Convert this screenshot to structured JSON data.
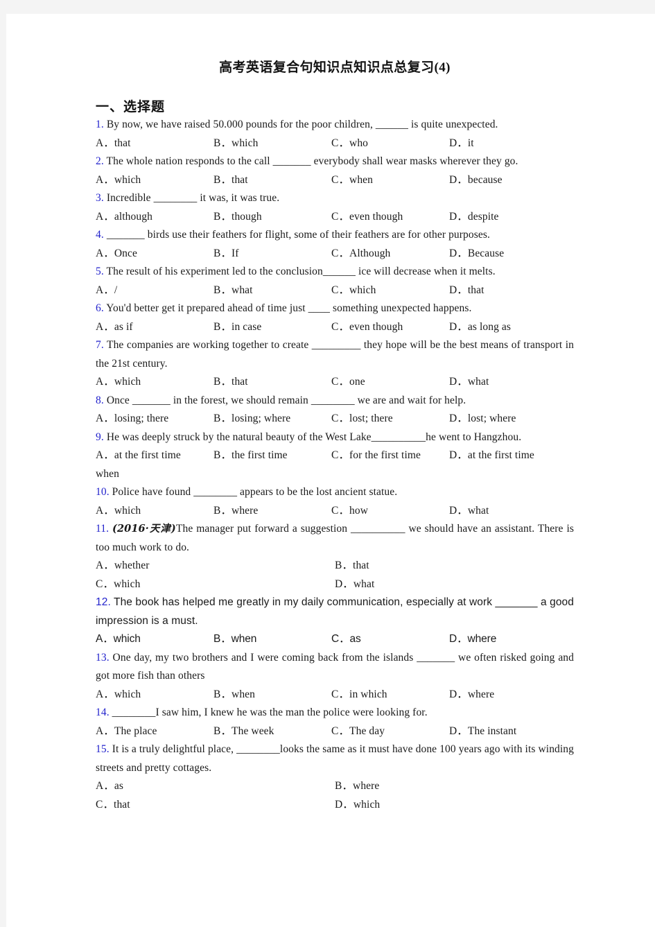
{
  "document": {
    "title": "高考英语复合句知识点知识点总复习(4)",
    "section_heading": "一、选择题"
  },
  "questions": [
    {
      "number": "1.",
      "stem": "By now, we have raised 50.000 pounds for the poor children, ______ is quite unexpected.",
      "layout": "four",
      "options": [
        "A．that",
        "B．which",
        "C．who",
        "D．it"
      ]
    },
    {
      "number": "2.",
      "stem": "The whole nation responds to the call _______ everybody shall wear masks wherever they go.",
      "layout": "four",
      "options": [
        "A．which",
        "B．that",
        "C．when",
        "D．because"
      ]
    },
    {
      "number": "3.",
      "stem": "Incredible ________ it was, it was true.",
      "layout": "four",
      "options": [
        "A．although",
        "B．though",
        "C．even though",
        "D．despite"
      ]
    },
    {
      "number": "4.",
      "stem": "_______ birds use their feathers for flight, some of their feathers are for other purposes.",
      "layout": "four",
      "options": [
        "A．Once",
        "B．If",
        "C．Although",
        "D．Because"
      ]
    },
    {
      "number": "5.",
      "stem": "The result of his experiment led to the conclusion______ ice will decrease when it melts.",
      "layout": "four",
      "options": [
        "A．/",
        "B．what",
        "C．which",
        "D．that"
      ]
    },
    {
      "number": "6.",
      "stem": "You'd better get it prepared ahead of time just ____ something unexpected happens.",
      "layout": "four",
      "options": [
        "A．as if",
        "B．in case",
        "C．even though",
        "D．as long as"
      ]
    },
    {
      "number": "7.",
      "stem": "The companies are working together to create _________ they hope will be the best means of transport in the 21st century.",
      "layout": "four",
      "options": [
        "A．which",
        "B．that",
        "C．one",
        "D．what"
      ]
    },
    {
      "number": "8.",
      "stem": "Once _______ in the forest, we should remain ________ we are and wait for help.",
      "layout": "four",
      "options": [
        "A．losing; there",
        "B．losing; where",
        "C．lost; there",
        "D．lost; where"
      ]
    },
    {
      "number": "9.",
      "stem": "He was deeply struck by the natural beauty of the West Lake__________he went to Hangzhou.",
      "layout": "four",
      "options": [
        "A．at the first time",
        "B．the first time",
        "C．for the first time",
        "D．at the first time"
      ],
      "options_overflow": "when"
    },
    {
      "number": "10.",
      "stem": "Police have found ________ appears to be the lost ancient statue.",
      "layout": "four",
      "options": [
        "A．which",
        "B．where",
        "C．how",
        "D．what"
      ]
    },
    {
      "number": "11.",
      "stem_prefix": "(2016·天津)",
      "stem": "The manager put forward a suggestion __________ we should have an assistant. There is too much work to do.",
      "layout": "two",
      "options": [
        "A．whether",
        "B．that",
        "C．which",
        "D．what"
      ]
    },
    {
      "number": "12.",
      "stem": "The book has helped me greatly in my daily communication, especially at work _______ a good impression is a must.",
      "layout": "four",
      "font": "sans",
      "options": [
        "A．which",
        "B．when",
        "C．as",
        "D．where"
      ]
    },
    {
      "number": "13.",
      "stem": "One day, my two brothers and I were coming back from the islands _______ we often risked going and got more fish than others",
      "layout": "four",
      "options": [
        "A．which",
        "B．when",
        "C．in which",
        "D．where"
      ]
    },
    {
      "number": "14.",
      "stem": "________I saw him, I knew he was the man the police were looking for.",
      "layout": "four",
      "options": [
        "A．The place",
        "B．The week",
        "C．The day",
        "D．The instant"
      ]
    },
    {
      "number": "15.",
      "stem": "It is a truly delightful place, ________looks the same as it must have done 100 years ago with its winding streets and pretty cottages.",
      "layout": "two",
      "options": [
        "A．as",
        "B．where",
        "C．that",
        "D．which"
      ]
    }
  ]
}
